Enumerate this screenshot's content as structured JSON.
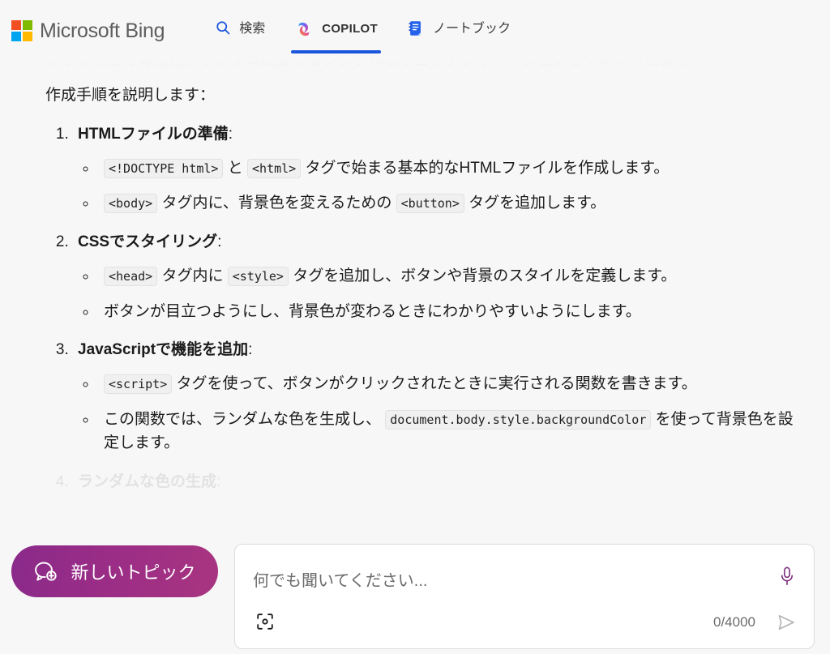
{
  "header": {
    "brand": "Microsoft Bing",
    "logo_colors": [
      "#f25022",
      "#7fba00",
      "#00a4ef",
      "#ffb900"
    ],
    "tabs": [
      {
        "id": "search",
        "label": "検索",
        "icon": "search-icon",
        "active": false
      },
      {
        "id": "copilot",
        "label": "COPILOT",
        "icon": "copilot-icon",
        "active": true
      },
      {
        "id": "notebook",
        "label": "ノートブック",
        "icon": "notebook-icon",
        "active": false
      }
    ],
    "active_tab_underline_color": "#1a56db"
  },
  "conversation": {
    "faded_top_line": "ブラウザ上で背景色がランダムに変わるシンプルなウェブアプリケーションをテキストにより",
    "intro": "作成手順を説明します：",
    "steps": [
      {
        "number": "1.",
        "title": "HTMLファイルの準備",
        "colon": ":",
        "substeps": [
          {
            "parts": [
              {
                "type": "code",
                "text": "<!DOCTYPE html>"
              },
              {
                "type": "text",
                "text": " と "
              },
              {
                "type": "code",
                "text": "<html>"
              },
              {
                "type": "text",
                "text": " タグで始まる基本的なHTMLファイルを作成します。"
              }
            ]
          },
          {
            "parts": [
              {
                "type": "code",
                "text": "<body>"
              },
              {
                "type": "text",
                "text": " タグ内に、背景色を変えるための "
              },
              {
                "type": "code",
                "text": "<button>"
              },
              {
                "type": "text",
                "text": " タグを追加します。"
              }
            ]
          }
        ]
      },
      {
        "number": "2.",
        "title": "CSSでスタイリング",
        "colon": ":",
        "substeps": [
          {
            "parts": [
              {
                "type": "code",
                "text": "<head>"
              },
              {
                "type": "text",
                "text": " タグ内に "
              },
              {
                "type": "code",
                "text": "<style>"
              },
              {
                "type": "text",
                "text": " タグを追加し、ボタンや背景のスタイルを定義します。"
              }
            ]
          },
          {
            "parts": [
              {
                "type": "text",
                "text": "ボタンが目立つようにし、背景色が変わるときにわかりやすいようにします。"
              }
            ]
          }
        ]
      },
      {
        "number": "3.",
        "title": "JavaScriptで機能を追加",
        "colon": ":",
        "substeps": [
          {
            "parts": [
              {
                "type": "code",
                "text": "<script>"
              },
              {
                "type": "text",
                "text": " タグを使って、ボタンがクリックされたときに実行される関数を書きます。"
              }
            ]
          },
          {
            "parts": [
              {
                "type": "text",
                "text": "この関数では、ランダムな色を生成し、 "
              },
              {
                "type": "code",
                "text": "document.body.style.backgroundColor"
              },
              {
                "type": "text",
                "text": " を使って背景色を設定します。"
              }
            ]
          }
        ]
      },
      {
        "number": "4.",
        "title": "ランダムな色の生成",
        "colon": ":",
        "faded": true,
        "substeps": []
      }
    ]
  },
  "composer": {
    "new_topic_label": "新しいトピック",
    "new_topic_icon": "chat-plus-icon",
    "new_topic_gradient": [
      "#8a2a8a",
      "#a83580"
    ],
    "input_placeholder": "何でも聞いてください...",
    "input_value": "",
    "mic_icon": "microphone-icon",
    "mic_color": "#7a2a7a",
    "camera_icon": "visual-search-camera-icon",
    "char_counter": "0/4000",
    "send_icon": "send-arrow-icon"
  }
}
